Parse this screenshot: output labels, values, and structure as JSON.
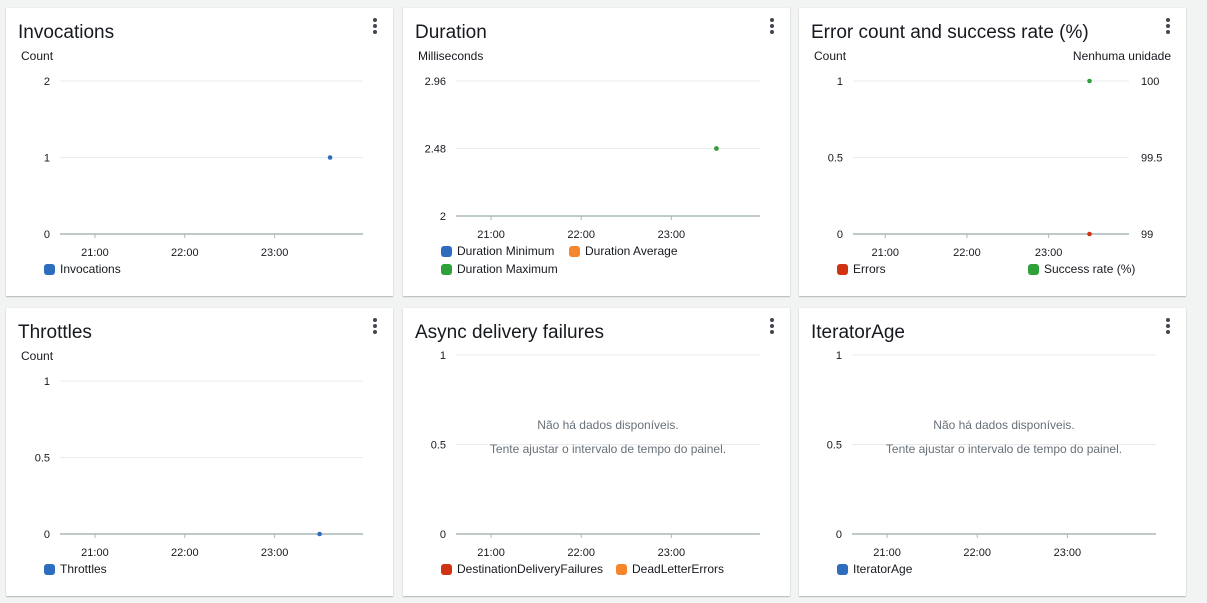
{
  "colors": {
    "blue": "#2e6dbe",
    "orange": "#f5862b",
    "green": "#2ea13b",
    "red": "#d13212",
    "axis": "#545b64",
    "grid": "#e9ebed",
    "point_blue": "#2e6dbe",
    "point_green": "#2ea13b",
    "point_red": "#d13212"
  },
  "panels": [
    {
      "id": "invocations",
      "title": "Invocations",
      "unit_left": "Count",
      "unit_right": "",
      "chart_data": {
        "type": "scatter",
        "x_ticks": [
          "21:00",
          "22:00",
          "23:00"
        ],
        "y_ticks": [
          "0",
          "1",
          "2"
        ],
        "ylim": [
          0,
          2
        ],
        "series": [
          {
            "name": "Invocations",
            "color": "#2e6dbe",
            "points": [
              {
                "x": "23:37",
                "y": 1
              }
            ]
          }
        ]
      },
      "legend": [
        {
          "label": "Invocations",
          "color": "#2e6dbe"
        }
      ],
      "no_data": null
    },
    {
      "id": "duration",
      "title": "Duration",
      "unit_left": "Milliseconds",
      "unit_right": "",
      "chart_data": {
        "type": "scatter",
        "x_ticks": [
          "21:00",
          "22:00",
          "23:00"
        ],
        "y_ticks": [
          "2",
          "2.48",
          "2.96"
        ],
        "ylim": [
          2,
          2.96
        ],
        "series": [
          {
            "name": "Duration Minimum",
            "color": "#2e6dbe",
            "points": [
              {
                "x": "23:30",
                "y": 2.48
              }
            ]
          },
          {
            "name": "Duration Average",
            "color": "#f5862b",
            "points": [
              {
                "x": "23:30",
                "y": 2.48
              }
            ]
          },
          {
            "name": "Duration Maximum",
            "color": "#2ea13b",
            "points": [
              {
                "x": "23:30",
                "y": 2.48
              }
            ]
          }
        ]
      },
      "legend": [
        {
          "label": "Duration Minimum",
          "color": "#2e6dbe"
        },
        {
          "label": "Duration Average",
          "color": "#f5862b"
        },
        {
          "label": "Duration Maximum",
          "color": "#2ea13b"
        }
      ],
      "no_data": null
    },
    {
      "id": "errors",
      "title": "Error count and success rate (%)",
      "unit_left": "Count",
      "unit_right": "Nenhuma unidade",
      "chart_data": {
        "type": "scatter",
        "x_ticks": [
          "21:00",
          "22:00",
          "23:00"
        ],
        "y_ticks": [
          "0",
          "0.5",
          "1"
        ],
        "y2_ticks": [
          "99",
          "99.5",
          "100"
        ],
        "ylim": [
          0,
          1
        ],
        "y2lim": [
          99,
          100
        ],
        "series": [
          {
            "name": "Errors",
            "color": "#d13212",
            "axis": "left",
            "points": [
              {
                "x": "23:30",
                "y": 0
              }
            ]
          },
          {
            "name": "Success rate (%)",
            "color": "#2ea13b",
            "axis": "right",
            "points": [
              {
                "x": "23:30",
                "y": 100
              }
            ]
          }
        ]
      },
      "legend": [
        {
          "label": "Errors",
          "color": "#d13212"
        },
        {
          "label": "Success rate (%)",
          "color": "#2ea13b"
        }
      ],
      "no_data": null
    },
    {
      "id": "throttles",
      "title": "Throttles",
      "unit_left": "Count",
      "unit_right": "",
      "chart_data": {
        "type": "scatter",
        "x_ticks": [
          "21:00",
          "22:00",
          "23:00"
        ],
        "y_ticks": [
          "0",
          "0.5",
          "1"
        ],
        "ylim": [
          0,
          1
        ],
        "series": [
          {
            "name": "Throttles",
            "color": "#2e6dbe",
            "points": [
              {
                "x": "23:30",
                "y": 0
              }
            ]
          }
        ]
      },
      "legend": [
        {
          "label": "Throttles",
          "color": "#2e6dbe"
        }
      ],
      "no_data": null
    },
    {
      "id": "async",
      "title": "Async delivery failures",
      "unit_left": "",
      "unit_right": "",
      "chart_data": {
        "type": "scatter",
        "x_ticks": [
          "21:00",
          "22:00",
          "23:00"
        ],
        "y_ticks": [
          "0",
          "0.5",
          "1"
        ],
        "ylim": [
          0,
          1
        ],
        "series": [
          {
            "name": "DestinationDeliveryFailures",
            "color": "#d13212",
            "points": []
          },
          {
            "name": "DeadLetterErrors",
            "color": "#f5862b",
            "points": []
          }
        ]
      },
      "legend": [
        {
          "label": "DestinationDeliveryFailures",
          "color": "#d13212"
        },
        {
          "label": "DeadLetterErrors",
          "color": "#f5862b"
        }
      ],
      "no_data": {
        "line1": "Não há dados disponíveis.",
        "line2": "Tente ajustar o intervalo de tempo do painel."
      }
    },
    {
      "id": "iterator",
      "title": "IteratorAge",
      "unit_left": "",
      "unit_right": "",
      "chart_data": {
        "type": "scatter",
        "x_ticks": [
          "21:00",
          "22:00",
          "23:00"
        ],
        "y_ticks": [
          "0",
          "0.5",
          "1"
        ],
        "ylim": [
          0,
          1
        ],
        "series": [
          {
            "name": "IteratorAge",
            "color": "#2e6dbe",
            "points": []
          }
        ]
      },
      "legend": [
        {
          "label": "IteratorAge",
          "color": "#2e6dbe"
        }
      ],
      "no_data": {
        "line1": "Não há dados disponíveis.",
        "line2": "Tente ajustar o intervalo de tempo do painel."
      }
    }
  ]
}
